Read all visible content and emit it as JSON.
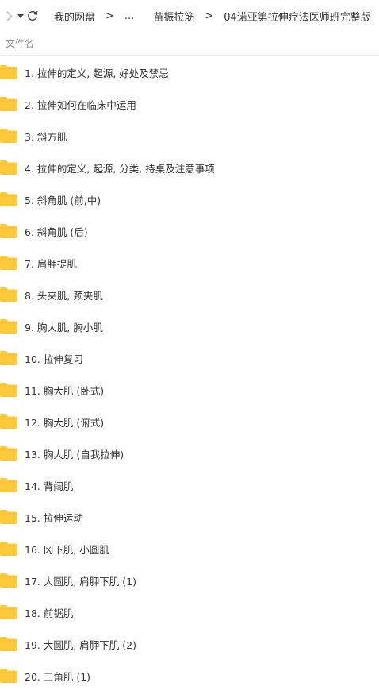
{
  "toolbar": {
    "forward_icon": "chevron-right-icon",
    "history_icon": "caret-down-icon",
    "refresh_icon": "refresh-icon",
    "breadcrumbs": [
      "我的网盘",
      "...",
      "苗振拉筋",
      "04诺亚第拉伸疗法医师班完整版"
    ],
    "separator": ">"
  },
  "list_header": {
    "name_column": "文件名"
  },
  "colors": {
    "folder": "#FFC93C",
    "text": "#333333",
    "header_text": "#888888"
  },
  "files": [
    {
      "name": "1. 拉伸的定义, 起源, 好处及禁忌",
      "type": "folder"
    },
    {
      "name": "2. 拉伸如何在临床中运用",
      "type": "folder"
    },
    {
      "name": "3. 斜方肌",
      "type": "folder"
    },
    {
      "name": "4. 拉伸的定义, 起源, 分类, 持桌及注意事项",
      "type": "folder"
    },
    {
      "name": "5. 斜角肌 (前,中)",
      "type": "folder"
    },
    {
      "name": "6. 斜角肌 (后)",
      "type": "folder"
    },
    {
      "name": "7. 肩胛提肌",
      "type": "folder"
    },
    {
      "name": "8. 头夹肌, 颈夹肌",
      "type": "folder"
    },
    {
      "name": "9. 胸大肌, 胸小肌",
      "type": "folder"
    },
    {
      "name": "10. 拉伸复习",
      "type": "folder"
    },
    {
      "name": "11. 胸大肌 (卧式)",
      "type": "folder"
    },
    {
      "name": "12. 胸大肌 (俯式)",
      "type": "folder"
    },
    {
      "name": "13. 胸大肌 (自我拉伸)",
      "type": "folder"
    },
    {
      "name": "14. 背阔肌",
      "type": "folder"
    },
    {
      "name": "15. 拉伸运动",
      "type": "folder"
    },
    {
      "name": "16. 冈下肌, 小圆肌",
      "type": "folder"
    },
    {
      "name": "17. 大圆肌, 肩胛下肌 (1)",
      "type": "folder"
    },
    {
      "name": "18. 前锯肌",
      "type": "folder"
    },
    {
      "name": "19. 大圆肌, 肩胛下肌 (2)",
      "type": "folder"
    },
    {
      "name": "20. 三角肌 (1)",
      "type": "folder"
    }
  ]
}
